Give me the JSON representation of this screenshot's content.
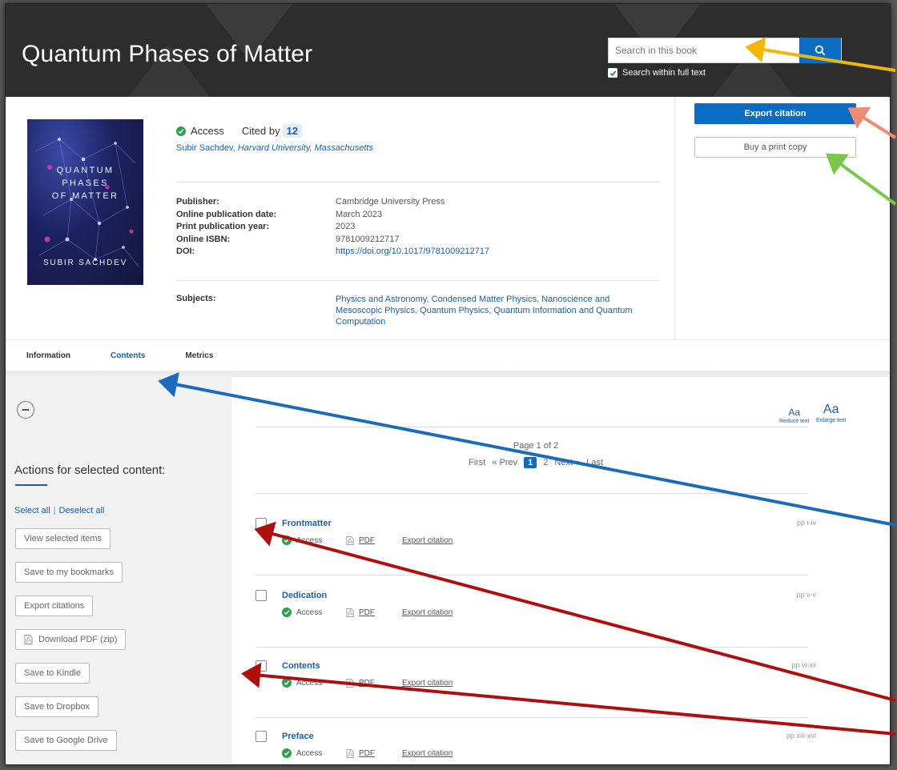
{
  "header": {
    "title": "Quantum Phases of Matter",
    "search_placeholder": "Search in this book",
    "search_full_text": "Search within full text"
  },
  "book": {
    "cover_lines": [
      "QUANTUM",
      "PHASES",
      "OF MATTER",
      "SUBIR SACHDEV"
    ],
    "access_label": "Access",
    "cited_label": "Cited by",
    "cited_count": "12",
    "author_name": "Subir Sachdev",
    "author_affiliation": "Harvard University, Massachusetts",
    "meta": [
      {
        "k": "Publisher:",
        "v": "Cambridge University Press"
      },
      {
        "k": "Online publication date:",
        "v": "March 2023"
      },
      {
        "k": "Print publication year:",
        "v": "2023"
      },
      {
        "k": "Online ISBN:",
        "v": "9781009212717"
      },
      {
        "k": "DOI:",
        "v": "https://doi.org/10.1017/9781009212717"
      }
    ],
    "subjects_label": "Subjects:",
    "subjects": "Physics and Astronomy, Condensed Matter Physics, Nanoscience and Mesoscopic Physics, Quantum Physics, Quantum Information and Quantum Computation"
  },
  "actions": {
    "export_citation": "Export citation",
    "buy_print": "Buy a print copy"
  },
  "tabs": [
    "Information",
    "Contents",
    "Metrics"
  ],
  "sidebar": {
    "heading": "Actions for selected content:",
    "select_all": "Select all",
    "deselect_all": "Deselect all",
    "buttons": [
      "View selected items",
      "Save to my bookmarks",
      "Export citations",
      "Download PDF (zip)",
      "Save to Kindle",
      "Save to Dropbox",
      "Save to Google Drive"
    ]
  },
  "textsize": {
    "reduce_glyph": "Aa",
    "reduce_label": "Reduce text",
    "enlarge_glyph": "Aa",
    "enlarge_label": "Enlarge text"
  },
  "pagination": {
    "info": "Page 1 of 2",
    "first": "First",
    "prev": "« Prev",
    "current": "1",
    "next_page": "2",
    "next": "Next »",
    "last": "Last"
  },
  "items": [
    {
      "title": "Frontmatter",
      "pages": "pp i-iv",
      "access": "Access",
      "pdf": "PDF",
      "export": "Export citation"
    },
    {
      "title": "Dedication",
      "pages": "pp v-v",
      "access": "Access",
      "pdf": "PDF",
      "export": "Export citation"
    },
    {
      "title": "Contents",
      "pages": "pp vi-xii",
      "access": "Access",
      "pdf": "PDF",
      "export": "Export citation"
    },
    {
      "title": "Preface",
      "pages": "pp xiii-xvi",
      "access": "Access",
      "pdf": "PDF",
      "export": "Export citation"
    }
  ],
  "colors": {
    "brand_blue": "#0b6cc4",
    "arrow_yellow": "#f2b705",
    "arrow_salmon": "#f08a75",
    "arrow_green": "#7cc64a",
    "arrow_blue": "#1b6bbd",
    "arrow_red": "#b00d0d"
  }
}
